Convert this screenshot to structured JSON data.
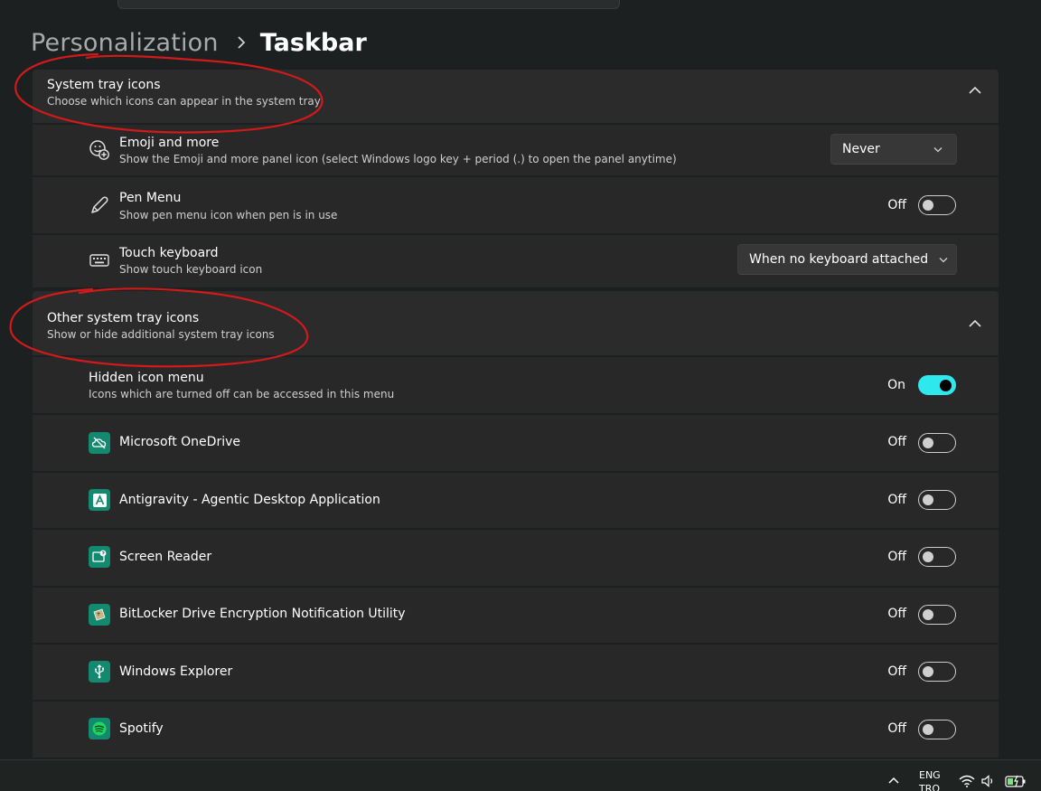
{
  "breadcrumb": {
    "parent": "Personalization",
    "current": "Taskbar"
  },
  "system_tray": {
    "title": "System tray icons",
    "description": "Choose which icons can appear in the system tray",
    "items": [
      {
        "title": "Emoji and more",
        "description": "Show the Emoji and more panel icon (select Windows logo key + period (.) to open the panel anytime)",
        "control": "dropdown",
        "value": "Never"
      },
      {
        "title": "Pen Menu",
        "description": "Show pen menu icon when pen is in use",
        "control": "toggle",
        "state": "Off"
      },
      {
        "title": "Touch keyboard",
        "description": "Show touch keyboard icon",
        "control": "dropdown",
        "value": "When no keyboard attached"
      }
    ]
  },
  "other_tray": {
    "title": "Other system tray icons",
    "description": "Show or hide additional system tray icons",
    "hidden_menu": {
      "title": "Hidden icon menu",
      "description": "Icons which are turned off can be accessed in this menu",
      "state": "On"
    },
    "apps": [
      {
        "name": "Microsoft OneDrive",
        "state": "Off",
        "icon": "onedrive-icon"
      },
      {
        "name": "Antigravity - Agentic Desktop Application",
        "state": "Off",
        "icon": "antigravity-icon"
      },
      {
        "name": "Screen Reader",
        "state": "Off",
        "icon": "screen-reader-icon"
      },
      {
        "name": "BitLocker Drive Encryption Notification Utility",
        "state": "Off",
        "icon": "bitlocker-icon"
      },
      {
        "name": "Windows Explorer",
        "state": "Off",
        "icon": "usb-icon"
      },
      {
        "name": "Spotify",
        "state": "Off",
        "icon": "spotify-icon"
      }
    ]
  },
  "taskbar": {
    "language_line1": "ENG",
    "language_line2": "TRQ"
  },
  "colors": {
    "accent": "#2ee8ee",
    "annotation": "#d11a1a",
    "app_icon_bg": "#13896f"
  }
}
